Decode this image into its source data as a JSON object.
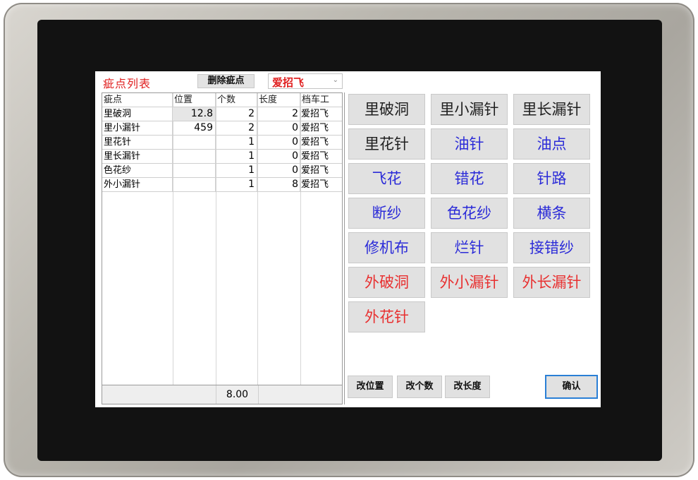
{
  "header": {
    "title": "疵点列表",
    "delete_label": "删除疵点",
    "operator_value": "爱招飞",
    "chevron": "⌄"
  },
  "table": {
    "columns": [
      "疵点",
      "位置",
      "个数",
      "长度",
      "档车工"
    ],
    "rows": [
      {
        "name": "里破洞",
        "position": "12.8",
        "count": "2",
        "length": "2",
        "worker": "爱招飞"
      },
      {
        "name": "里小漏针",
        "position": "459",
        "count": "2",
        "length": "0",
        "worker": "爱招飞"
      },
      {
        "name": "里花针",
        "position": "",
        "count": "1",
        "length": "0",
        "worker": "爱招飞"
      },
      {
        "name": "里长漏针",
        "position": "",
        "count": "1",
        "length": "0",
        "worker": "爱招飞"
      },
      {
        "name": "色花纱",
        "position": "",
        "count": "1",
        "length": "0",
        "worker": "爱招飞"
      },
      {
        "name": "外小漏针",
        "position": "",
        "count": "1",
        "length": "8",
        "worker": "爱招飞"
      }
    ],
    "total": "8.00"
  },
  "defects": [
    {
      "label": "里破洞",
      "color": "#202020"
    },
    {
      "label": "里小漏针",
      "color": "#202020"
    },
    {
      "label": "里长漏针",
      "color": "#202020"
    },
    {
      "label": "里花针",
      "color": "#202020"
    },
    {
      "label": "油针",
      "color": "#2b2bd8"
    },
    {
      "label": "油点",
      "color": "#2b2bd8"
    },
    {
      "label": "飞花",
      "color": "#2b2bd8"
    },
    {
      "label": "错花",
      "color": "#2b2bd8"
    },
    {
      "label": "针路",
      "color": "#2b2bd8"
    },
    {
      "label": "断纱",
      "color": "#2b2bd8"
    },
    {
      "label": "色花纱",
      "color": "#2b2bd8"
    },
    {
      "label": "横条",
      "color": "#2b2bd8"
    },
    {
      "label": "修机布",
      "color": "#2b2bd8"
    },
    {
      "label": "烂针",
      "color": "#2b2bd8"
    },
    {
      "label": "接错纱",
      "color": "#2b2bd8"
    },
    {
      "label": "外破洞",
      "color": "#e83030"
    },
    {
      "label": "外小漏针",
      "color": "#e83030"
    },
    {
      "label": "外长漏针",
      "color": "#e83030"
    },
    {
      "label": "外花针",
      "color": "#e83030"
    }
  ],
  "actions": {
    "change_position": "改位置",
    "change_count": "改个数",
    "change_length": "改长度",
    "confirm": "确认"
  }
}
